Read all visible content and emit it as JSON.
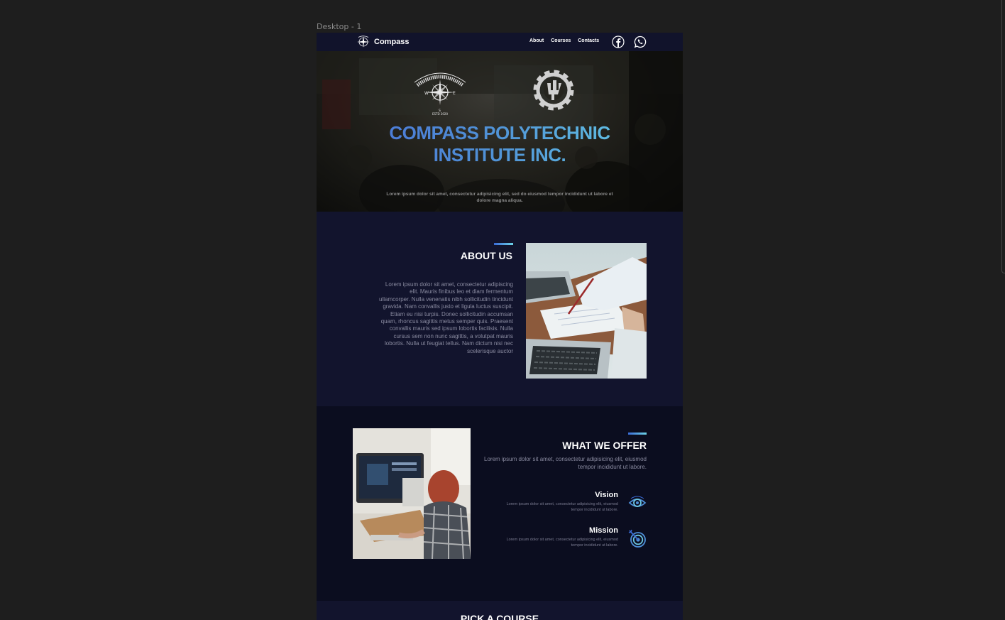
{
  "frame": {
    "label": "Desktop - 1"
  },
  "nav": {
    "brand": "Compass",
    "links": [
      "About",
      "Courses",
      "Contacts"
    ],
    "social": [
      "facebook-icon",
      "whatsapp-icon"
    ]
  },
  "hero": {
    "logo_text": "COMPASS POLYTECHNIC INSTITUTE INC.",
    "logo_est": "ESTD 2020",
    "title_line1": "COMPASS POLYTECHNIC",
    "title_line2": "INSTITUTE INC.",
    "subtitle": "Lorem ipsum dolor sit amet, consectetur adipisicing elit, sed do eiusmod tempor incididunt ut labore et dolore magna aliqua."
  },
  "about": {
    "title": "ABOUT US",
    "body": "Lorem ipsum dolor sit amet, consectetur adipiscing elit. Mauris finibus leo et diam fermentum ullamcorper. Nulla venenatis nibh sollicitudin tincidunt gravida. Nam convallis justo et ligula luctus suscipit. Etiam eu nisi turpis. Donec sollicitudin accumsan quam, rhoncus sagittis metus semper quis. Praesent convallis mauris sed ipsum lobortis facilisis. Nulla cursus sem non nunc sagittis, a volutpat mauris lobortis. Nulla ut feugiat tellus. Nam dictum nisi nec scelerisque auctor"
  },
  "offer": {
    "title": "WHAT WE OFFER",
    "subtitle": "Lorem ipsum dolor sit amet, consectetur adipisicing elit, eiusmod tempor incididunt ut labore.",
    "features": [
      {
        "name": "Vision",
        "text": "Lorem ipsum dolor sit amet, consectetur adipisicing elit, eiusmod tempor incididunt ut labore.",
        "icon": "eye-icon"
      },
      {
        "name": "Mission",
        "text": "Lorem ipsum dolor sit amet, consectetur adipisicing elit, eiusmod tempor incididunt ut labore.",
        "icon": "target-icon"
      }
    ]
  },
  "course": {
    "title": "PICK A COURSE"
  },
  "colors": {
    "canvas": "#1e1e1e",
    "page": "#12142d",
    "dark_section": "#0b0d1f",
    "accent_start": "#3a6bd6",
    "accent_end": "#6dd3e6",
    "muted_text": "#8a8ba0"
  }
}
